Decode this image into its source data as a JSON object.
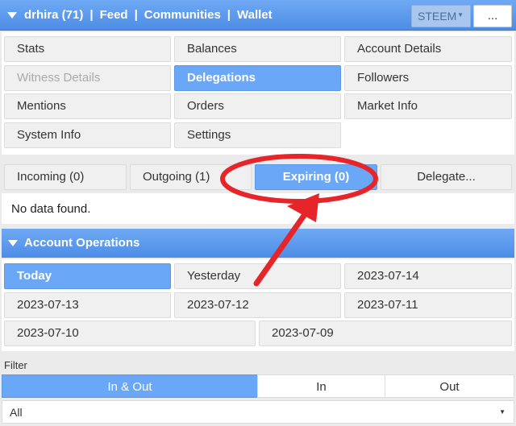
{
  "header": {
    "user": "drhira (71)",
    "links": [
      "Feed",
      "Communities",
      "Wallet"
    ],
    "chain_select": "STEEM",
    "more_label": "..."
  },
  "menu": {
    "stats": "Stats",
    "balances": "Balances",
    "account_details": "Account Details",
    "witness_details": "Witness Details",
    "delegations": "Delegations",
    "followers": "Followers",
    "mentions": "Mentions",
    "orders": "Orders",
    "market_info": "Market Info",
    "system_info": "System Info",
    "settings": "Settings"
  },
  "delegation_tabs": {
    "incoming": "Incoming (0)",
    "outgoing": "Outgoing (1)",
    "expiring": "Expiring (0)",
    "delegate": "Delegate..."
  },
  "no_data": "No data found.",
  "operations": {
    "title": "Account Operations",
    "dates": [
      "Today",
      "Yesterday",
      "2023-07-14",
      "2023-07-13",
      "2023-07-12",
      "2023-07-11",
      "2023-07-10",
      "2023-07-09"
    ]
  },
  "filter": {
    "label": "Filter",
    "options": [
      "In & Out",
      "In",
      "Out"
    ],
    "select_value": "All"
  },
  "colors": {
    "accent": "#6aa8f7",
    "annotation": "#e5252a"
  }
}
